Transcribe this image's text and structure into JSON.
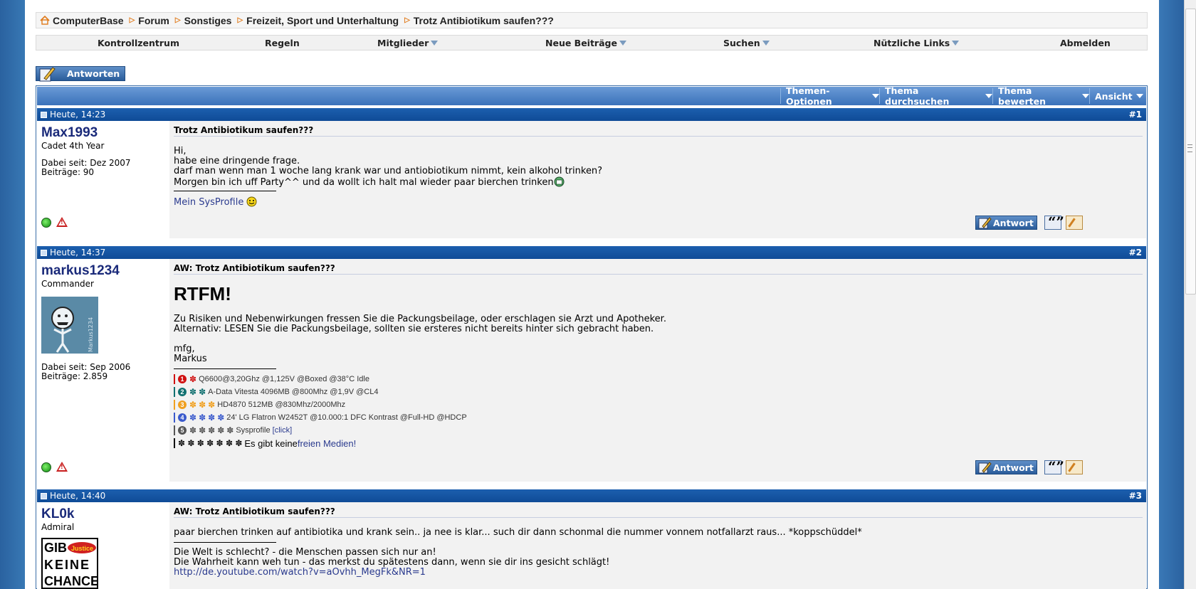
{
  "breadcrumb": {
    "items": [
      "ComputerBase",
      "Forum",
      "Sonstiges",
      "Freizeit, Sport und Unterhaltung",
      "Trotz Antibiotikum saufen???"
    ]
  },
  "navbar": {
    "items": [
      "Kontrollzentrum",
      "Regeln",
      "Mitglieder",
      "Neue Beiträge",
      "Suchen",
      "Nützliche Links",
      "Abmelden"
    ]
  },
  "reply_button": {
    "label": "Antworten"
  },
  "thread_toolbar": {
    "items": [
      "Themen-Optionen",
      "Thema durchsuchen",
      "Thema bewerten",
      "Ansicht"
    ]
  },
  "post_actions": {
    "reply_label": "Antwort"
  },
  "posts": [
    {
      "date": "Heute, 14:23",
      "number": "#1",
      "username": "Max1993",
      "rank": "Cadet 4th Year",
      "joined": "Dabei seit: Dez 2007",
      "posts": "Beiträge: 90",
      "title": "Trotz Antibiotikum saufen???",
      "lines": [
        "Hi,",
        "habe eine dringende frage.",
        "darf man wenn man 1 woche lang krank war und antiobiotikum nimmt, kein alkohol trinken?",
        "Morgen bin ich uff Party^^ und da wollt ich halt mal wieder paar bierchen trinken"
      ],
      "signature_link": "Mein SysProfile"
    },
    {
      "date": "Heute, 14:37",
      "number": "#2",
      "username": "markus1234",
      "rank": "Commander",
      "avatar_caption": "Markus1234",
      "joined": "Dabei seit: Sep 2006",
      "posts": "Beiträge: 2.859",
      "title": "AW: Trotz Antibiotikum saufen???",
      "heading": "RTFM!",
      "lines": [
        "Zu Risiken und Nebenwirkungen fressen Sie die Packungsbeilage, oder erschlagen sie Arzt und Apotheker.",
        "Alternativ: LESEN Sie die Packungsbeilage, sollten sie ersteres nicht bereits hinter sich gebracht haben.",
        "",
        "mfg,",
        "Markus"
      ],
      "signature_rows": [
        {
          "num": "1",
          "color": "#d01010",
          "text": "Q6600@3,20Ghz @1,125V @Boxed @38°C Idle"
        },
        {
          "num": "2",
          "color": "#107070",
          "text": "A-Data Vitesta 4096MB @800Mhz @1,9V @CL4"
        },
        {
          "num": "3",
          "color": "#f0a020",
          "text": "HD4870 512MB @830Mhz/2000Mhz"
        },
        {
          "num": "4",
          "color": "#3a5acc",
          "text": "24' LG Flatron W2452T @10.000:1 DFC Kontrast @Full-HD @HDCP"
        },
        {
          "num": "5",
          "color": "#555555",
          "text": "Sysprofile",
          "link": "[click]"
        }
      ],
      "signature_last": {
        "text": "Es gibt keine ",
        "link": "freien Medien!"
      }
    },
    {
      "date": "Heute, 14:40",
      "number": "#3",
      "username": "KL0k",
      "rank": "Admiral",
      "avatar_text": [
        "GIB",
        "KEINE",
        "CHANCE"
      ],
      "avatar_badge": "Justice",
      "title": "AW: Trotz Antibiotikum saufen???",
      "lines": [
        "paar bierchen trinken auf antibiotika und krank sein.. ja nee is klar... such dir dann schonmal die nummer vonnem notfallarzt raus... *koppschüddel*"
      ],
      "signature_lines": [
        "Die Welt is schlecht? - die Menschen passen sich nur an!",
        "Die Wahrheit kann weh tun - das merkst du spätestens dann, wenn sie dir ins gesicht schlägt!"
      ],
      "signature_link": "http://de.youtube.com/watch?v=aOvhh_MegFk&NR=1"
    }
  ]
}
